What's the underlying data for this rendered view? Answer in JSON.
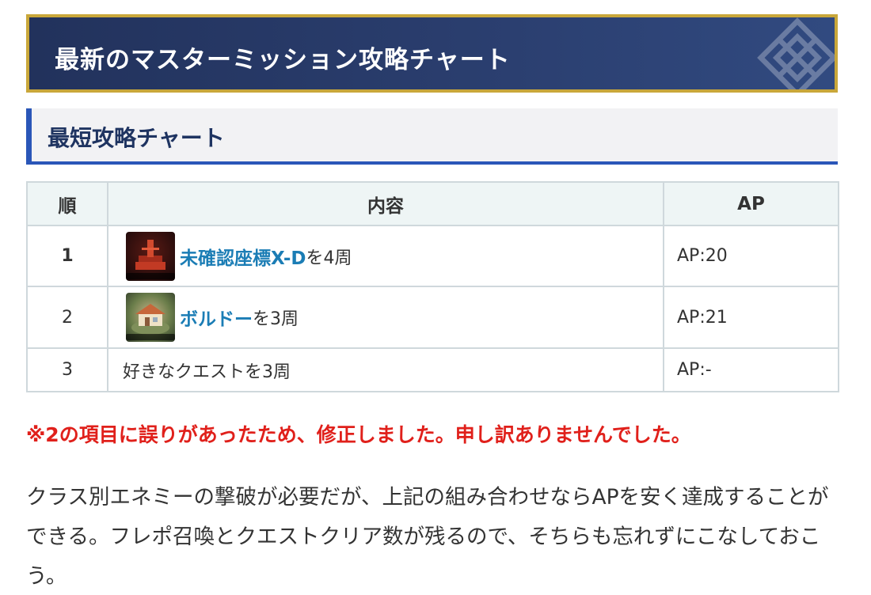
{
  "banner": {
    "title": "最新のマスターミッション攻略チャート",
    "emblem_icon": "diamond-emblem-icon"
  },
  "section": {
    "title": "最短攻略チャート"
  },
  "table": {
    "headers": [
      "順",
      "内容",
      "AP"
    ],
    "rows": [
      {
        "order": "1",
        "quest_link": "未確認座標X-D",
        "suffix": "を4周",
        "ap": "AP:20",
        "thumb_icon": "quest-thumbnail-unknown-coordinates-icon"
      },
      {
        "order": "2",
        "quest_link": "ボルドー",
        "suffix": "を3周",
        "ap": "AP:21",
        "thumb_icon": "quest-thumbnail-bordeaux-icon"
      },
      {
        "order": "3",
        "text": "好きなクエストを3周",
        "ap": "AP:-"
      }
    ]
  },
  "note": {
    "correction": "※2の項目に誤りがあったため、修正しました。申し訳ありませんでした。",
    "color": "#e0201b"
  },
  "paragraph": {
    "text": "クラス別エネミーの撃破が必要だが、上記の組み合わせならAPを安く達成することができる。フレポ召喚とクエストクリア数が残るので、そちらも忘れずにこなしておこう。"
  },
  "colors": {
    "banner_bg": "#2b3f70",
    "banner_border": "#c9a73a",
    "heading_accent": "#2a56b8",
    "link": "#1b7db5"
  }
}
